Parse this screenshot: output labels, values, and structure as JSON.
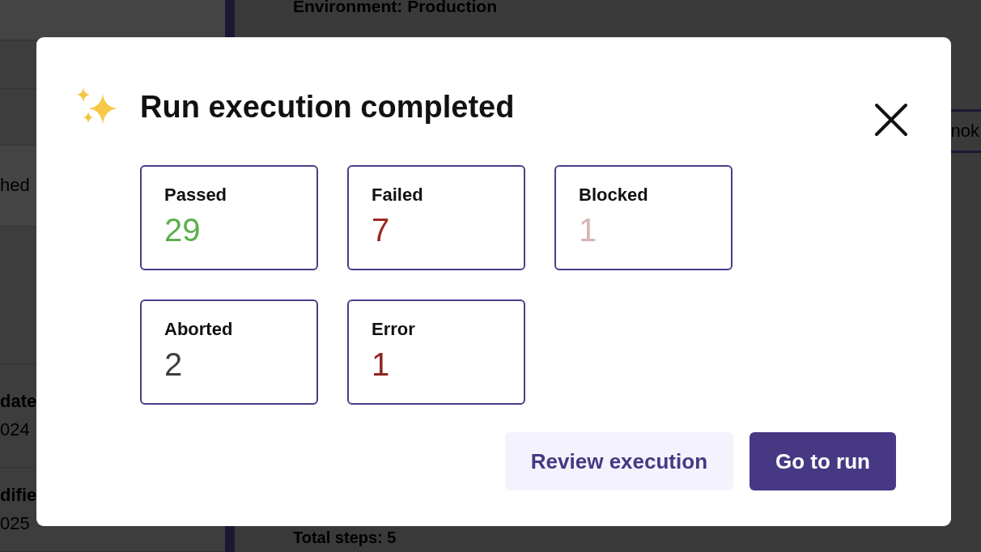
{
  "background": {
    "heading": "Environment: Production",
    "left_fragments": [
      {
        "text": "hed",
        "bold": false
      },
      {
        "text": "date",
        "bold": true
      },
      {
        "text": "024",
        "bold": false
      },
      {
        "text": "difie",
        "bold": true
      },
      {
        "text": "025",
        "bold": false
      }
    ],
    "tab_fragment": "nok",
    "footer": "Total steps: 5"
  },
  "dialog": {
    "title": "Run execution completed",
    "stats": [
      {
        "label": "Passed",
        "value": "29",
        "color": "#5cb04c"
      },
      {
        "label": "Failed",
        "value": "7",
        "color": "#9b2a22"
      },
      {
        "label": "Blocked",
        "value": "1",
        "color": "#d8b3b3"
      },
      {
        "label": "Aborted",
        "value": "2",
        "color": "#3f3f3f"
      },
      {
        "label": "Error",
        "value": "1",
        "color": "#8e2620"
      }
    ],
    "buttons": [
      {
        "label": "Review execution",
        "kind": "secondary"
      },
      {
        "label": "Go to run",
        "kind": "primary"
      }
    ]
  }
}
